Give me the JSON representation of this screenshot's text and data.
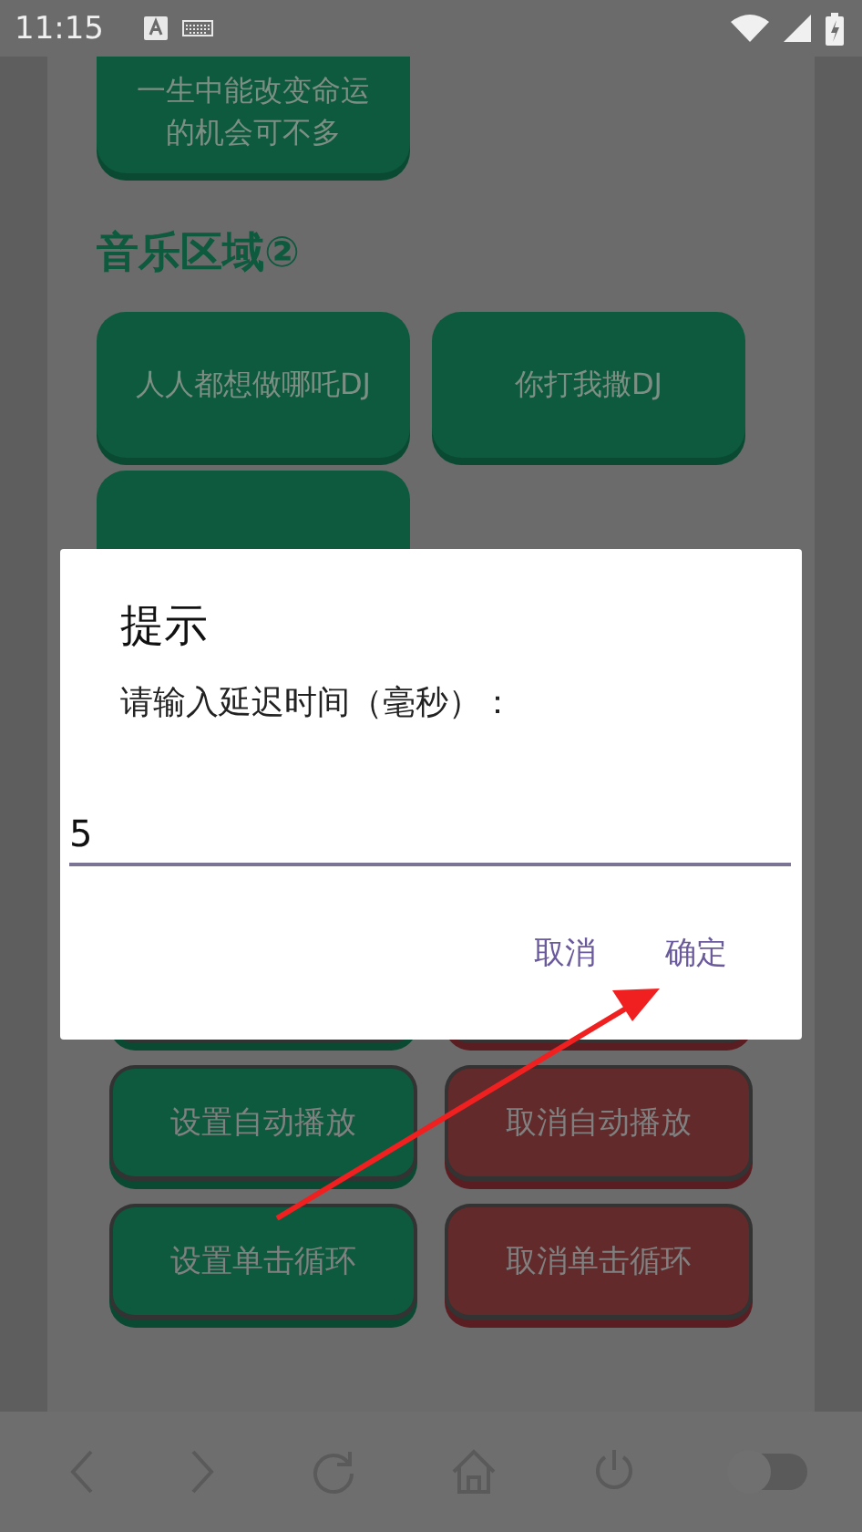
{
  "status_bar": {
    "time": "11:15"
  },
  "top_button": {
    "label": "一生中能改变命运的机会可不多"
  },
  "heading": "音乐区域②",
  "music_buttons": [
    {
      "kind": "labeled",
      "label": "人人都想做哪吒DJ"
    },
    {
      "kind": "labeled",
      "label": "你打我撒DJ"
    },
    {
      "kind": "covered"
    }
  ],
  "control_rows": [
    [
      {
        "kind": "set"
      },
      {
        "kind": "cancel"
      }
    ],
    [
      {
        "kind": "set",
        "label": "设置自动播放"
      },
      {
        "kind": "cancel",
        "label": "取消自动播放"
      }
    ],
    [
      {
        "kind": "set",
        "label": "设置单击循环"
      },
      {
        "kind": "cancel",
        "label": "取消单击循环"
      }
    ]
  ],
  "dialog": {
    "title": "提示",
    "message": "请输入延迟时间（毫秒）：",
    "input_value": "5",
    "buttons": [
      "取消",
      "确定"
    ]
  },
  "nav_bar": {
    "toggle": {
      "on": false
    }
  }
}
